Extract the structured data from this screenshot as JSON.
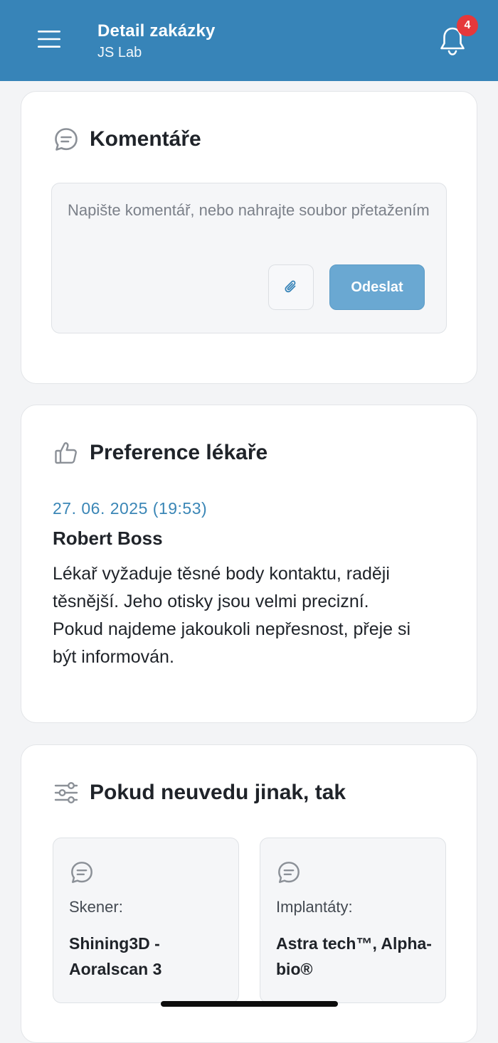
{
  "header": {
    "title": "Detail zakázky",
    "subtitle": "JS Lab",
    "notification_count": "4",
    "background_color": "#3784b8"
  },
  "comments": {
    "title": "Komentáře",
    "icon": "chat-bubble-icon",
    "placeholder": "Napište komentář, nebo nahrajte soubor přetažením",
    "attach_icon": "paperclip-icon",
    "send_label": "Odeslat"
  },
  "preference": {
    "title": "Preference lékaře",
    "icon": "thumbs-up-icon",
    "date": "27. 06. 2025 (19:53)",
    "author": "Robert Boss",
    "text": "Lékař vyžaduje těsné body kontaktu, raději těsnější. Jeho otisky jsou velmi precizní. Pokud najdeme jakoukoli nepřesnost, přeje si být informován."
  },
  "defaults": {
    "title": "Pokud neuvedu jinak, tak",
    "icon": "sliders-icon",
    "items": [
      {
        "label": "Skener:",
        "value": "Shining3D - Aoralscan 3",
        "icon": "chat-bubble-icon"
      },
      {
        "label": "Implantáty:",
        "value": "Astra tech™, Alpha-bio®",
        "icon": "chat-bubble-icon"
      }
    ]
  },
  "colors": {
    "accent": "#3784b8",
    "date": "#3a86b6",
    "send_button": "#6aa8d2",
    "badge": "#e5383b"
  }
}
